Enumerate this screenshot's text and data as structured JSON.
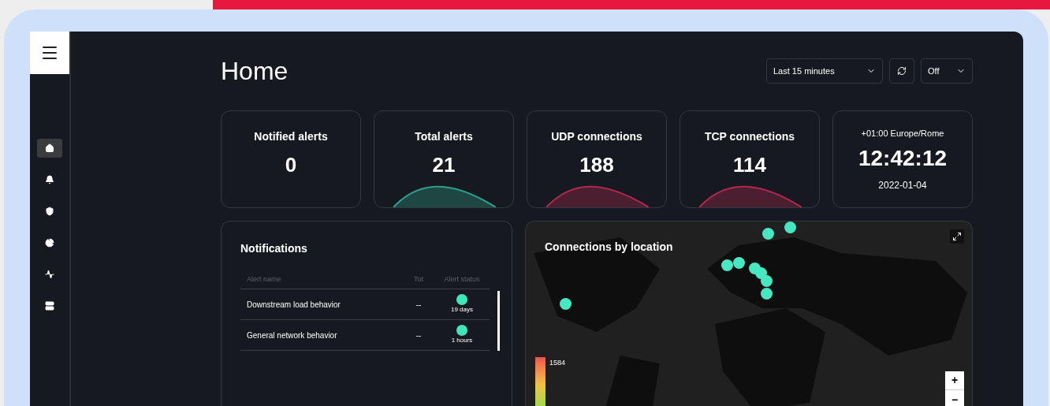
{
  "sidebar": {
    "items": [
      {
        "selected": true
      },
      {
        "selected": false
      },
      {
        "selected": false
      },
      {
        "selected": false
      },
      {
        "selected": false
      },
      {
        "selected": false
      }
    ]
  },
  "header": {
    "title": "Home",
    "time_range": "Last 15 minutes",
    "refresh": "Off"
  },
  "stat_cards": [
    {
      "label": "Notified alerts",
      "value": "0"
    },
    {
      "label": "Total alerts",
      "value": "21",
      "color": "#2f9e8a"
    },
    {
      "label": "UDP connections",
      "value": "188",
      "color": "#b0284f"
    },
    {
      "label": "TCP connections",
      "value": "114",
      "color": "#b0284f"
    }
  ],
  "clock": {
    "timezone": "+01:00 Europe/Rome",
    "time": "12:42:12",
    "date": "2022-01-04"
  },
  "notifications": {
    "title": "Notifications",
    "columns": [
      "Alert name",
      "Tot",
      "Alert status"
    ],
    "rows": [
      {
        "name": "Downstream load behavior",
        "tot": "--",
        "status": "19 days",
        "color": "#3ee6b8"
      },
      {
        "name": "General network behavior",
        "tot": "--",
        "status": "1 hours",
        "color": "#3ee6b8"
      }
    ]
  },
  "map": {
    "title": "Connections by location",
    "legend_max": "1584",
    "zoom_in": "+",
    "zoom_out": "−"
  }
}
